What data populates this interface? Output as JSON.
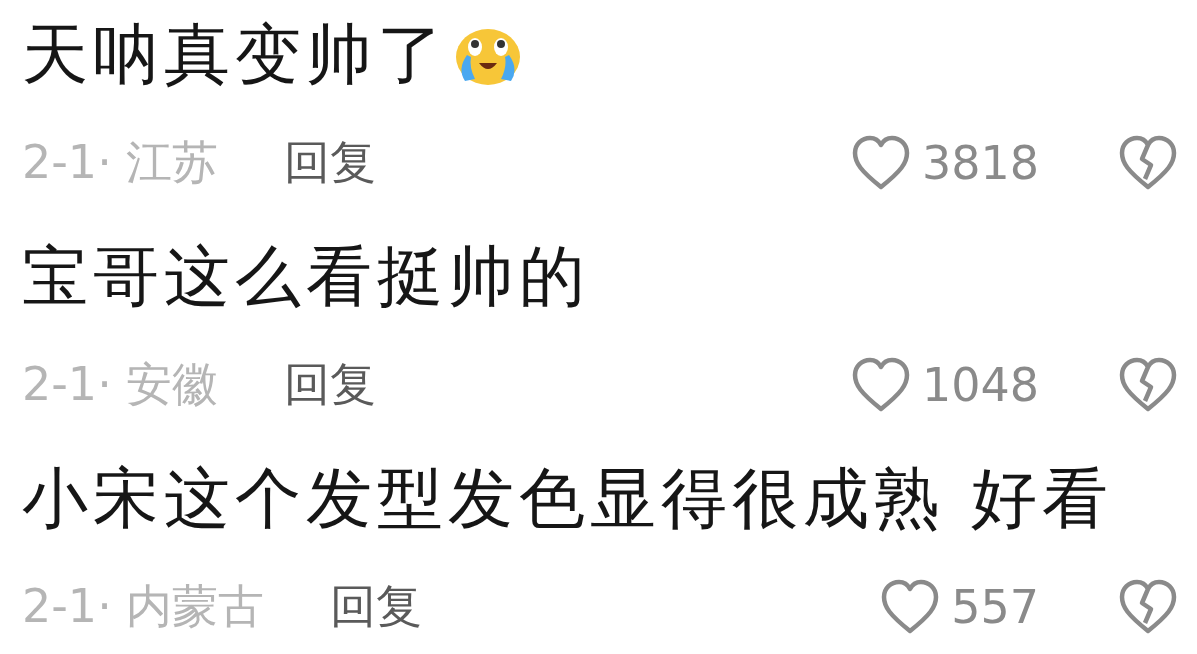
{
  "comments": [
    {
      "text": "天呐真变帅了",
      "emoji": true,
      "meta": "2-1· 江苏",
      "reply": "回复",
      "likes": "3818"
    },
    {
      "text": "宝哥这么看挺帅的",
      "emoji": false,
      "meta": "2-1· 安徽",
      "reply": "回复",
      "likes": "1048"
    },
    {
      "text": "小宋这个发型发色显得很成熟 好看",
      "emoji": false,
      "meta": "2-1· 内蒙古",
      "reply": "回复",
      "likes": "557"
    }
  ]
}
